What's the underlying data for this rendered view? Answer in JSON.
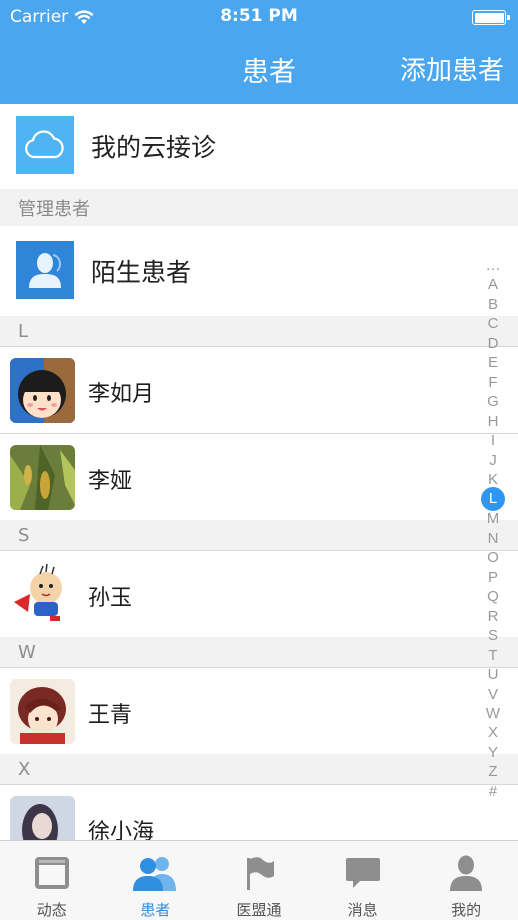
{
  "status": {
    "carrier": "Carrier",
    "time": "8:51 PM"
  },
  "nav": {
    "title": "患者",
    "add_label": "添加患者"
  },
  "cloud_row": {
    "label": "我的云接诊",
    "icon": "cloud-icon"
  },
  "manage_section": {
    "label": "管理患者"
  },
  "stranger_row": {
    "label": "陌生患者",
    "icon": "person-icon"
  },
  "groups": [
    {
      "letter": "L",
      "patients": [
        {
          "name": "李如月"
        },
        {
          "name": "李娅"
        }
      ]
    },
    {
      "letter": "S",
      "patients": [
        {
          "name": "孙玉"
        }
      ]
    },
    {
      "letter": "W",
      "patients": [
        {
          "name": "王青"
        }
      ]
    },
    {
      "letter": "X",
      "patients": [
        {
          "name": "徐小海"
        }
      ]
    }
  ],
  "index": [
    "…",
    "A",
    "B",
    "C",
    "D",
    "E",
    "F",
    "G",
    "H",
    "I",
    "J",
    "K",
    "L",
    "M",
    "N",
    "O",
    "P",
    "Q",
    "R",
    "S",
    "T",
    "U",
    "V",
    "W",
    "X",
    "Y",
    "Z",
    "#"
  ],
  "index_active": "L",
  "tabs": [
    {
      "label": "动态",
      "icon": "browser-icon"
    },
    {
      "label": "患者",
      "icon": "people-icon"
    },
    {
      "label": "医盟通",
      "icon": "flag-icon"
    },
    {
      "label": "消息",
      "icon": "chat-bubble-icon"
    },
    {
      "label": "我的",
      "icon": "user-icon"
    }
  ],
  "active_tab": "患者",
  "colors": {
    "nav_bg": "#4aa6ee",
    "accent": "#2f8fe0",
    "section_bg": "#f2f2f2"
  }
}
